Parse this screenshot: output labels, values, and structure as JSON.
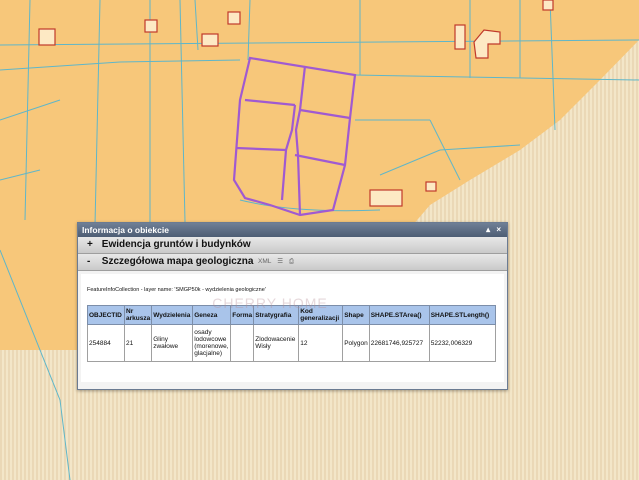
{
  "popup": {
    "title": "Informacja o obiekcie",
    "window_controls": "▴ ×",
    "sections": [
      {
        "sign": "+",
        "label": "Ewidencja gruntów i budynków"
      },
      {
        "sign": "-",
        "label": "Szczegółowa mapa geologiczna"
      }
    ],
    "tools": {
      "xml": "XML"
    },
    "caption": "FeatureInfoCollection - layer name: 'SMGP50k - wydzielenia geologiczne'",
    "table": {
      "headers": [
        "OBJECTID",
        "Nr arkusza",
        "Wydzielenia",
        "Geneza",
        "Forma",
        "Stratygrafia",
        "Kod generalizacji",
        "Shape",
        "SHAPE.STArea()",
        "SHAPE.STLength()"
      ],
      "rows": [
        [
          "254884",
          "21",
          "Gliny zwałowe",
          "osady lodowcowe (morenowe, glacjalne)",
          "",
          "Zlodowacenie Wisły",
          "12",
          "Polygon",
          "22681746,925727",
          "52232,006329"
        ]
      ]
    }
  },
  "watermark": "CHERRY HOME",
  "colors": {
    "map_background": "#f7c77a",
    "parcel_line": "#5fb6c9",
    "selection": "#a05ad1",
    "building": "#c0392b",
    "header_blue": "#a9c4ea"
  }
}
